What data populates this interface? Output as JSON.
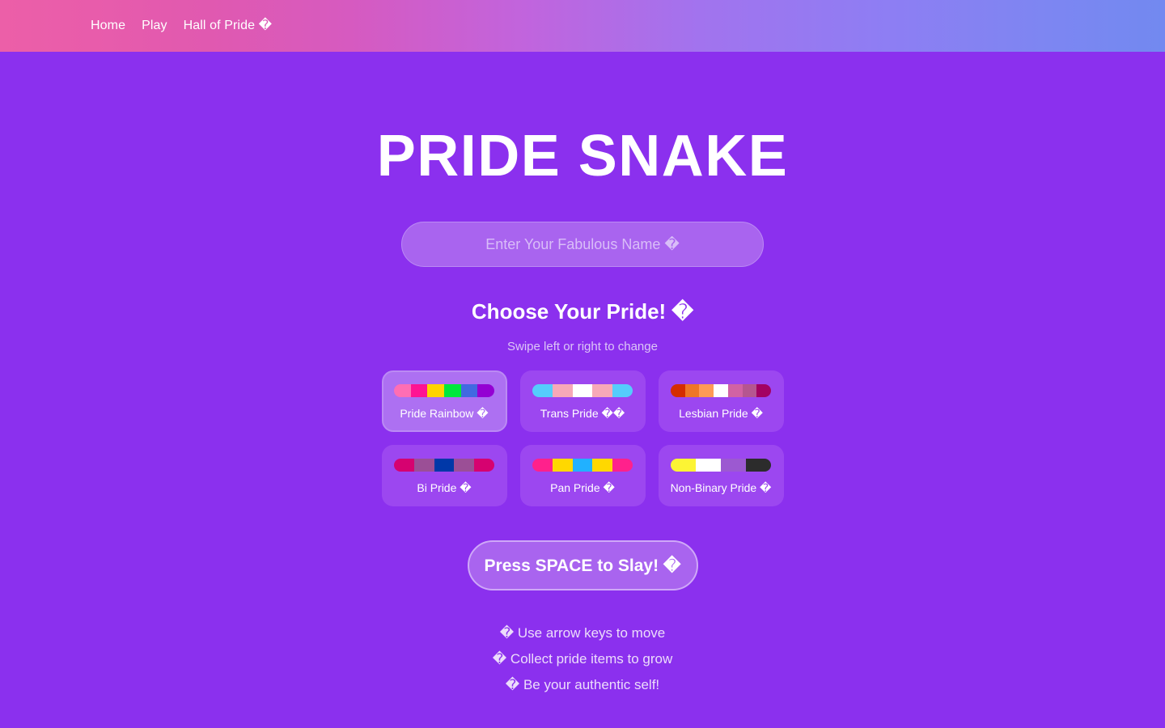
{
  "theme": {
    "page_background": "#8b30ee",
    "navbar_gradient_start": "#ec5fa8",
    "navbar_gradient_end": "#7289f0",
    "card_background": "#9c47f0",
    "card_selected_background": "#ad70f2",
    "accent_border": "#bb8af4",
    "text_primary": "#ffffff",
    "text_muted": "#ddc6f7"
  },
  "navbar": {
    "links": [
      {
        "label": "Home",
        "name": "nav-link-home"
      },
      {
        "label": "Play",
        "name": "nav-link-play"
      },
      {
        "label": "Hall of Pride �",
        "name": "nav-link-hall-of-pride"
      }
    ]
  },
  "main": {
    "title": "PRIDE SNAKE",
    "name_field": {
      "placeholder": "Enter Your Fabulous Name �",
      "value": ""
    },
    "choose_heading": "Choose Your Pride! �",
    "swipe_hint": "Swipe left or right to change",
    "cta_label": "Press SPACE to Slay! �"
  },
  "flags": [
    {
      "id": "pride-rainbow",
      "label": "Pride Rainbow �",
      "selected": true,
      "colors": [
        "#ff6eb4",
        "#ff1493",
        "#ffd400",
        "#00e83c",
        "#4169e1",
        "#9400d3"
      ]
    },
    {
      "id": "trans-pride",
      "label": "Trans Pride ��",
      "selected": false,
      "colors": [
        "#55cdfc",
        "#f7a8b8",
        "#ffffff",
        "#f7a8b8",
        "#55cdfc"
      ]
    },
    {
      "id": "lesbian-pride",
      "label": "Lesbian Pride �",
      "selected": false,
      "colors": [
        "#d52d00",
        "#ef7627",
        "#ff9a56",
        "#ffffff",
        "#d162a4",
        "#b55690",
        "#a30262"
      ]
    },
    {
      "id": "bi-pride",
      "label": "Bi Pride �",
      "selected": false,
      "colors": [
        "#d60270",
        "#9b4f96",
        "#0038a8",
        "#9b4f96",
        "#d60270"
      ]
    },
    {
      "id": "pan-pride",
      "label": "Pan Pride �",
      "selected": false,
      "colors": [
        "#ff218c",
        "#ffd800",
        "#21b1ff",
        "#ffd800",
        "#ff218c"
      ]
    },
    {
      "id": "non-binary-pride",
      "label": "Non-Binary Pride �",
      "selected": false,
      "colors": [
        "#fcf434",
        "#ffffff",
        "#9c59d1",
        "#2c2c2c"
      ]
    }
  ],
  "instructions": [
    "� Use arrow keys to move",
    "� Collect pride items to grow",
    "� Be your authentic self!"
  ]
}
